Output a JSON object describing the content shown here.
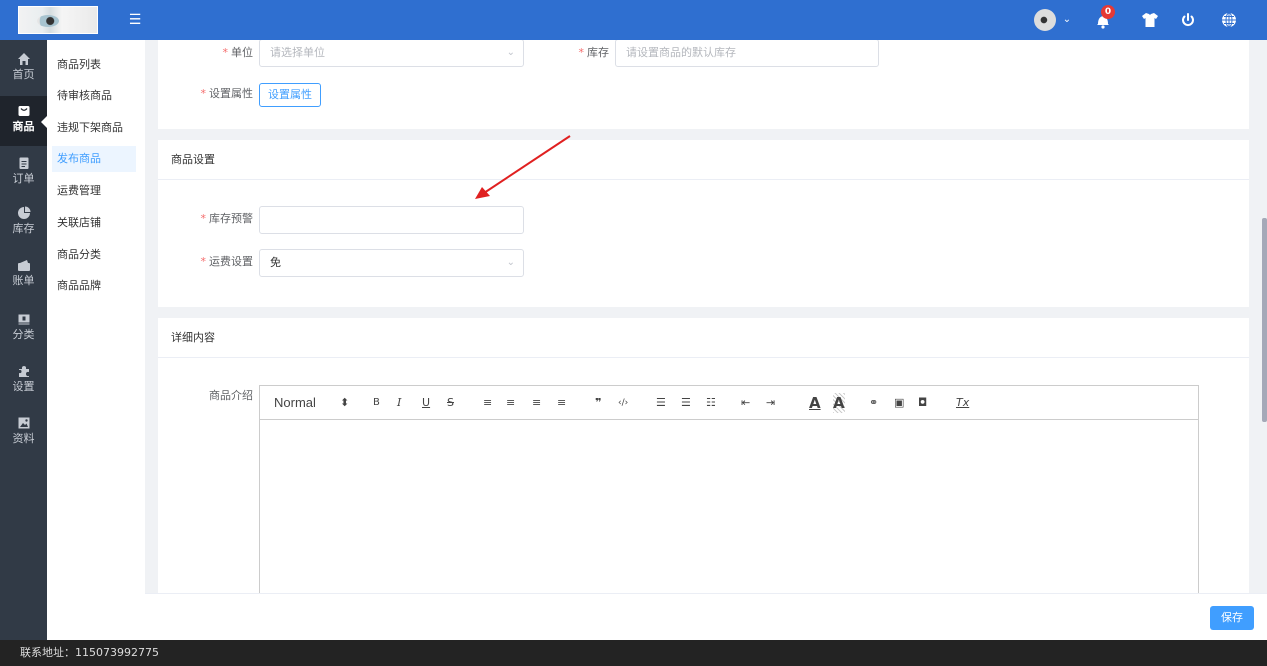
{
  "header": {
    "menu_toggle_icon": "☰",
    "notification_count": "0",
    "accent_color": "#2f6fd0"
  },
  "main_nav": [
    {
      "label": "首页",
      "icon": "home-icon",
      "glyph": "⌂"
    },
    {
      "label": "商品",
      "icon": "shopping-bag-icon",
      "glyph": "▣",
      "active": true
    },
    {
      "label": "订单",
      "icon": "clipboard-icon",
      "glyph": "▤"
    },
    {
      "label": "库存",
      "icon": "pie-chart-icon",
      "glyph": "◕"
    },
    {
      "label": "账单",
      "icon": "wallet-icon",
      "glyph": "▬"
    },
    {
      "label": "分类",
      "icon": "tag-icon",
      "glyph": "▭"
    },
    {
      "label": "设置",
      "icon": "puzzle-icon",
      "glyph": "✱"
    },
    {
      "label": "资料",
      "icon": "image-icon",
      "glyph": "▨"
    }
  ],
  "sub_nav": [
    {
      "label": "商品列表"
    },
    {
      "label": "待审核商品"
    },
    {
      "label": "违规下架商品"
    },
    {
      "label": "发布商品",
      "active": true
    },
    {
      "label": "运费管理"
    },
    {
      "label": "关联店铺"
    },
    {
      "label": "商品分类"
    },
    {
      "label": "商品品牌"
    }
  ],
  "basic_section": {
    "unit_label": "单位",
    "unit_placeholder": "请选择单位",
    "stock_label": "库存",
    "stock_placeholder": "请设置商品的默认库存",
    "attr_label": "设置属性",
    "attr_button": "设置属性"
  },
  "goods_settings": {
    "title": "商品设置",
    "stock_warning_label": "库存预警",
    "stock_warning_value": "",
    "shipping_label": "运费设置",
    "shipping_value": "免"
  },
  "detail_section": {
    "title": "详细内容",
    "intro_label": "商品介绍",
    "editor_format": "Normal",
    "toolbar": [
      {
        "name": "format-stepper-icon",
        "glyph": "⬍"
      },
      {
        "name": "bold-icon",
        "glyph": "B"
      },
      {
        "name": "italic-icon",
        "glyph": "I"
      },
      {
        "name": "underline-icon",
        "glyph": "U"
      },
      {
        "name": "strikethrough-icon",
        "glyph": "S"
      },
      {
        "name": "align-left-icon",
        "glyph": "≡"
      },
      {
        "name": "align-center-icon",
        "glyph": "≡"
      },
      {
        "name": "align-right-icon",
        "glyph": "≡"
      },
      {
        "name": "align-justify-icon",
        "glyph": "≡"
      },
      {
        "name": "blockquote-icon",
        "glyph": "❞"
      },
      {
        "name": "code-block-icon",
        "glyph": "‹/›"
      },
      {
        "name": "ordered-list-icon",
        "glyph": "☰"
      },
      {
        "name": "bullet-list-icon",
        "glyph": "☰"
      },
      {
        "name": "check-list-icon",
        "glyph": "☷"
      },
      {
        "name": "indent-decrease-icon",
        "glyph": "⇤"
      },
      {
        "name": "indent-increase-icon",
        "glyph": "⇥"
      },
      {
        "name": "text-color-icon",
        "glyph": "A"
      },
      {
        "name": "background-color-icon",
        "glyph": "A"
      },
      {
        "name": "link-icon",
        "glyph": "⚭"
      },
      {
        "name": "image-icon",
        "glyph": "▣"
      },
      {
        "name": "video-icon",
        "glyph": "◘"
      },
      {
        "name": "clear-format-icon",
        "glyph": "Tx"
      }
    ]
  },
  "footer": {
    "save_label": "保存"
  },
  "status_bar": {
    "contact": "联系地址：115073992775"
  },
  "annotation_color": "#e02020"
}
